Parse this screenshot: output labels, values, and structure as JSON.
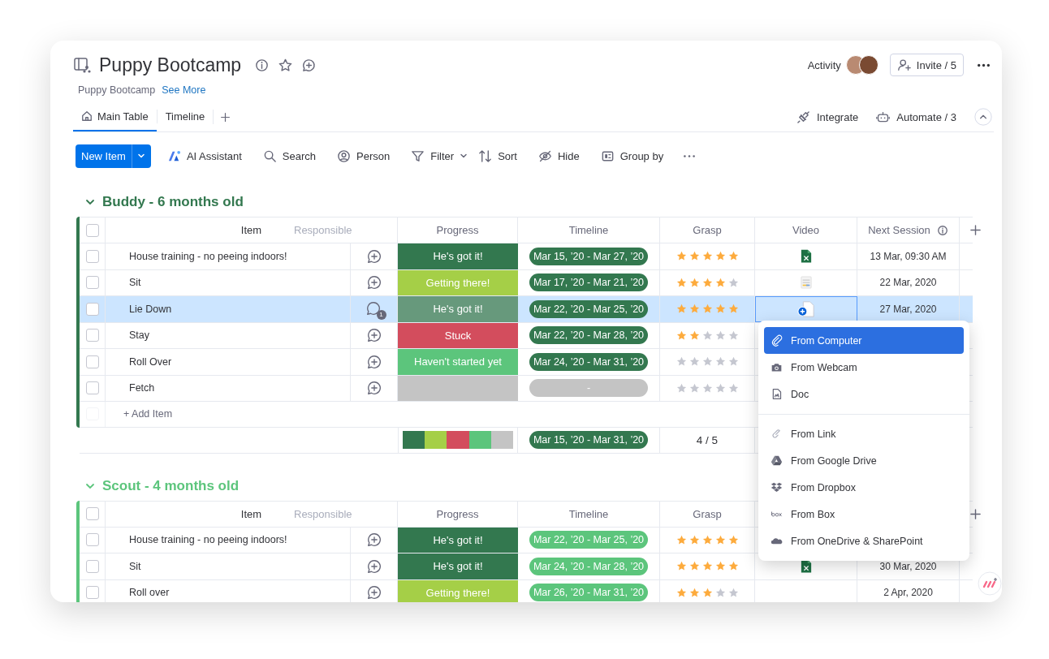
{
  "board": {
    "title": "Puppy Bootcamp",
    "description": "Puppy Bootcamp",
    "see_more": "See More",
    "activity": "Activity",
    "invite": "Invite / 5"
  },
  "tabs": [
    {
      "label": "Main Table",
      "selected": true,
      "kind": "home"
    },
    {
      "label": "Timeline",
      "selected": false,
      "kind": "plain"
    }
  ],
  "view_actions": [
    {
      "label": "Integrate",
      "kind": "integrate"
    },
    {
      "label": "Automate / 3",
      "kind": "automate"
    }
  ],
  "toolbar": {
    "new_item": "New Item",
    "items": [
      {
        "label": "AI Assistant",
        "kind": "ai"
      },
      {
        "label": "Search",
        "kind": "search"
      },
      {
        "label": "Person",
        "kind": "person"
      },
      {
        "label": "Filter",
        "kind": "filter"
      },
      {
        "label": "Sort",
        "kind": "sort"
      },
      {
        "label": "Hide",
        "kind": "hide"
      },
      {
        "label": "Group by",
        "kind": "group"
      }
    ]
  },
  "groups": [
    {
      "title": "Buddy - 6 months old",
      "color": "#33784f",
      "expanded": true,
      "all_checked": false,
      "columns": [
        "Item",
        "Progress",
        "Timeline",
        "Grasp",
        "Video",
        "Next Session"
      ],
      "ghost_column": "Responsible",
      "rows": [
        {
          "item": "House training - no peeing indoors!",
          "checked": false,
          "selected": false,
          "progress": {
            "label": "He's got it!",
            "color": "#33784f"
          },
          "timeline": {
            "label": "Mar 15, ’20 - Mar 27, ’20",
            "color": "#33784f"
          },
          "stars": 5,
          "video": {
            "kind": "excel"
          },
          "next_session": "13 Mar, 09:30 AM"
        },
        {
          "item": "Sit",
          "checked": false,
          "selected": false,
          "progress": {
            "label": "Getting there!",
            "color": "#a5cf47"
          },
          "timeline": {
            "label": "Mar 17, ’20 - Mar 21, ’20",
            "color": "#33784f"
          },
          "stars": 4,
          "video": {
            "kind": "image"
          },
          "next_session": "22 Mar, 2020"
        },
        {
          "item": "Lie Down",
          "checked": false,
          "selected": true,
          "updates": "1",
          "progress": {
            "label": "He's got it!",
            "color": "#67997c"
          },
          "timeline": {
            "label": "Mar 22, ’20 - Mar 25, ’20",
            "color": "#33784f"
          },
          "stars": 5,
          "video": {
            "kind": "add"
          },
          "next_session": "27 Mar, 2020"
        },
        {
          "item": "Stay",
          "checked": false,
          "selected": false,
          "progress": {
            "label": "Stuck",
            "color": "#d34d5d"
          },
          "timeline": {
            "label": "Mar 22, ’20 - Mar 28, ’20",
            "color": "#33784f"
          },
          "stars": 2
        },
        {
          "item": "Roll Over",
          "checked": false,
          "selected": false,
          "progress": {
            "label": "Haven't started yet",
            "color": "#5cc57c"
          },
          "timeline": {
            "label": "Mar 24, ’20 - Mar 31, ’20",
            "color": "#33784f"
          },
          "stars": 0
        },
        {
          "item": "Fetch",
          "checked": false,
          "selected": false,
          "progress": {
            "color": "#c4c4c4"
          },
          "timeline": {
            "label": "-",
            "color": "#c4c4c4"
          },
          "stars": 0
        }
      ],
      "add_item": {
        "label": "+ Add Item",
        "checked": false
      },
      "summary": {
        "segments": [
          {
            "color": "#33784f"
          },
          {
            "color": "#a5cf47"
          },
          {
            "color": "#d34d5d"
          },
          {
            "color": "#5cc57c"
          },
          {
            "color": "#c4c4c4"
          }
        ],
        "timeline": {
          "label": "Mar 15, ’20 - Mar 31, ’20",
          "color": "#33784f"
        },
        "grasp": "4 / 5"
      }
    },
    {
      "title": "Scout - 4 months old",
      "color": "#5cc57c",
      "expanded": true,
      "all_checked": false,
      "columns": [
        "Item",
        "Progress",
        "Timeline",
        "Grasp"
      ],
      "ghost_column": "Responsible",
      "rows": [
        {
          "item": "House training - no peeing indoors!",
          "checked": false,
          "selected": false,
          "progress": {
            "label": "He's got it!",
            "color": "#33784f"
          },
          "timeline": {
            "label": "Mar 22, ’20 - Mar 25, ’20",
            "color": "#5cc57c"
          },
          "stars": 5
        },
        {
          "item": "Sit",
          "checked": false,
          "selected": false,
          "progress": {
            "label": "He's got it!",
            "color": "#33784f"
          },
          "timeline": {
            "label": "Mar 24, ’20 - Mar 28, ’20",
            "color": "#5cc57c"
          },
          "stars": 5,
          "video": {
            "kind": "excel"
          },
          "next_session": "30 Mar, 2020"
        },
        {
          "item": "Roll over",
          "checked": false,
          "selected": false,
          "progress": {
            "label": "Getting there!",
            "color": "#a5cf47"
          },
          "timeline": {
            "label": "Mar 26, ’20 - Mar 31, ’20",
            "color": "#5cc57c"
          },
          "stars": 3,
          "next_session": "2 Apr, 2020"
        }
      ]
    }
  ],
  "upload_menu": {
    "sections": [
      [
        {
          "label": "From Computer",
          "kind": "computer",
          "selected": true
        },
        {
          "label": "From Webcam",
          "kind": "webcam",
          "selected": false
        },
        {
          "label": "Doc",
          "kind": "doc",
          "selected": false
        }
      ],
      [
        {
          "label": "From Link",
          "kind": "link",
          "selected": false
        },
        {
          "label": "From Google Drive",
          "kind": "gdrive",
          "selected": false
        },
        {
          "label": "From Dropbox",
          "kind": "dropbox",
          "selected": false
        },
        {
          "label": "From Box",
          "kind": "box",
          "selected": false
        },
        {
          "label": "From OneDrive & SharePoint",
          "kind": "onedrive",
          "selected": false
        }
      ]
    ]
  }
}
